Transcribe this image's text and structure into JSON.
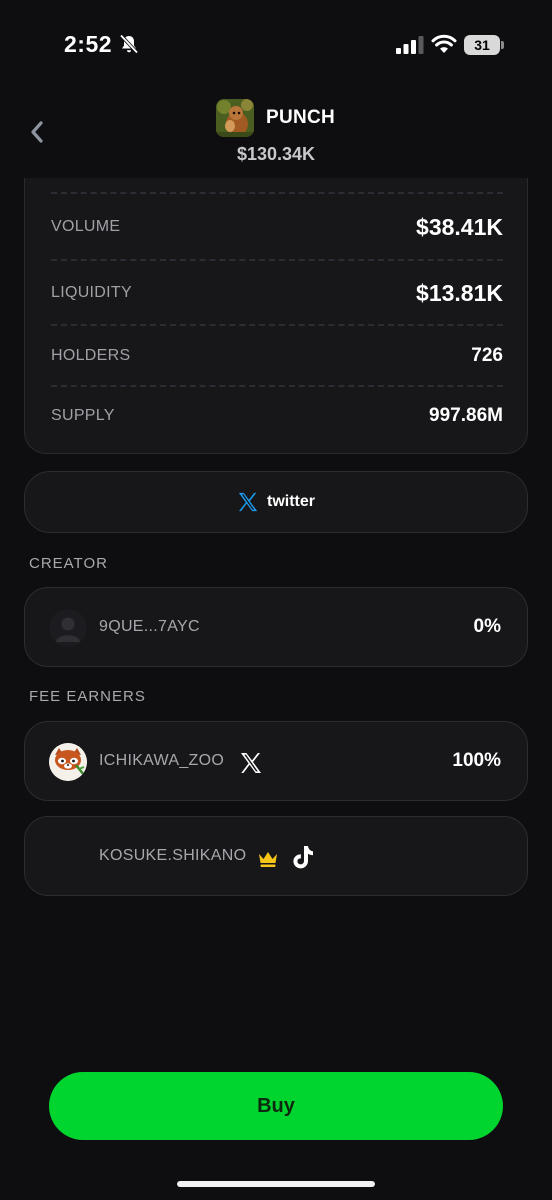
{
  "status_bar": {
    "time": "2:52",
    "battery": "31"
  },
  "header": {
    "token_name": "PUNCH",
    "market_cap": "$130.34K"
  },
  "stats": [
    {
      "label": "VOLUME",
      "value": "$38.41K"
    },
    {
      "label": "LIQUIDITY",
      "value": "$13.81K"
    },
    {
      "label": "HOLDERS",
      "value": "726"
    },
    {
      "label": "SUPPLY",
      "value": "997.86M"
    }
  ],
  "social": {
    "twitter_label": "twitter"
  },
  "creator": {
    "heading": "CREATOR",
    "name": "9QUE...7AYC",
    "share": "0%"
  },
  "fee_earners": {
    "heading": "FEE EARNERS",
    "items": [
      {
        "name": "ICHIKAWA_ZOO",
        "share": "100%",
        "platform_icon": "x-logo-icon"
      },
      {
        "name": "KOSUKE.SHIKANO",
        "share": "",
        "platform_icon": "tiktok-icon",
        "badge_icon": "crown-icon"
      }
    ]
  },
  "actions": {
    "buy_label": "Buy"
  },
  "colors": {
    "background": "#0e0e10",
    "card": "#17171a",
    "buy_green": "#00d42e",
    "twitter_blue": "#1d9bf0",
    "crown_gold": "#f5c518"
  }
}
